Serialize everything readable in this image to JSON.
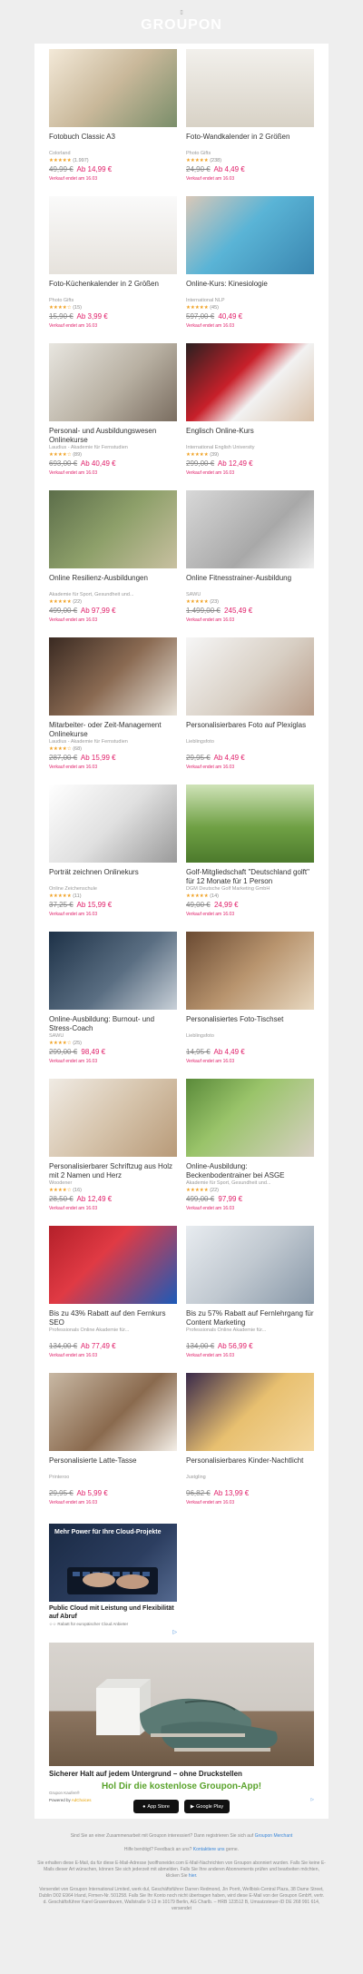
{
  "header": {
    "logo_alt": "Groupon",
    "logo_text": "GROUPON"
  },
  "deals": [
    {
      "title": "Fotobuch Classic A3",
      "merchant": "Colorland",
      "stars": "★★★★★",
      "reviews": "(1.997)",
      "old_price": "49,99 €",
      "new_price": "Ab 14,99 €",
      "ends": "Verkauf endet am 16.03"
    },
    {
      "title": "Foto-Wandkalender in 2 Größen",
      "merchant": "Photo Gifts",
      "stars": "★★★★★",
      "reviews": "(238)",
      "old_price": "24,90 €",
      "new_price": "Ab 4,49 €",
      "ends": "Verkauf endet am 16.03"
    },
    {
      "title": "Foto-Küchenkalender in 2 Größen",
      "merchant": "Photo Gifts",
      "stars": "★★★★☆",
      "reviews": "(15)",
      "old_price": "15,90 €",
      "new_price": "Ab 3,99 €",
      "ends": "Verkauf endet am 16.03"
    },
    {
      "title": "Online-Kurs: Kinesiologie",
      "merchant": "International NLP",
      "stars": "★★★★★",
      "reviews": "(45)",
      "old_price": "597,00 €",
      "new_price": "40,49 €",
      "ends": "Verkauf endet am 16.03"
    },
    {
      "title": "Personal- und Ausbildungswesen Onlinekurse",
      "merchant": "Laudius - Akademie für Fernstudien",
      "stars": "★★★★☆",
      "reviews": "(89)",
      "old_price": "693,00 €",
      "new_price": "Ab 40,49 €",
      "ends": "Verkauf endet am 16.03"
    },
    {
      "title": "Englisch Online-Kurs",
      "merchant": "International English University",
      "stars": "★★★★★",
      "reviews": "(39)",
      "old_price": "299,00 €",
      "new_price": "Ab 12,49 €",
      "ends": "Verkauf endet am 16.03"
    },
    {
      "title": "Online Resilienz-Ausbildungen",
      "merchant": "Akademie für Sport, Gesundheit und...",
      "stars": "★★★★★",
      "reviews": "(22)",
      "old_price": "499,00 €",
      "new_price": "Ab 97,99 €",
      "ends": "Verkauf endet am 16.03"
    },
    {
      "title": "Online Fitnesstrainer-Ausbildung",
      "merchant": "SAWU",
      "stars": "★★★★★",
      "reviews": "(23)",
      "old_price": "1.499,00 €",
      "new_price": "245,49 €",
      "ends": "Verkauf endet am 16.03"
    },
    {
      "title": "Mitarbeiter- oder Zeit-Management Onlinekurse",
      "merchant": "Laudius - Akademie für Fernstudien",
      "stars": "★★★★☆",
      "reviews": "(68)",
      "old_price": "287,00 €",
      "new_price": "Ab 15,99 €",
      "ends": "Verkauf endet am 16.03"
    },
    {
      "title": "Personalisierbares Foto auf Plexiglas",
      "merchant": "Lieblingsfoto",
      "stars": "",
      "reviews": "",
      "old_price": "29,95 €",
      "new_price": "Ab 4,49 €",
      "ends": "Verkauf endet am 16.03"
    },
    {
      "title": "Porträt zeichnen Onlinekurs",
      "merchant": "Online Zeichenschule",
      "stars": "★★★★★",
      "reviews": "(11)",
      "old_price": "37,25 €",
      "new_price": "Ab 15,99 €",
      "ends": "Verkauf endet am 16.03"
    },
    {
      "title": "Golf-Mitgliedschaft \"Deutschland golft\" für 12 Monate für 1 Person",
      "merchant": "DGM Deutsche Golf Marketing GmbH",
      "stars": "★★★★★",
      "reviews": "(14)",
      "old_price": "49,00 €",
      "new_price": "24,99 €",
      "ends": "Verkauf endet am 16.03"
    },
    {
      "title": "Online-Ausbildung: Burnout- und Stress-Coach",
      "merchant": "SAWU",
      "stars": "★★★★☆",
      "reviews": "(25)",
      "old_price": "299,00 €",
      "new_price": "98,49 €",
      "ends": "Verkauf endet am 16.03"
    },
    {
      "title": "Personalisiertes Foto-Tischset",
      "merchant": "Lieblingsfoto",
      "stars": "",
      "reviews": "",
      "old_price": "14,95 €",
      "new_price": "Ab 4,49 €",
      "ends": "Verkauf endet am 16.03"
    },
    {
      "title": "Personalisierbarer Schriftzug aus Holz mit 2 Namen und Herz",
      "merchant": "Woodener",
      "stars": "★★★★☆",
      "reviews": "(16)",
      "old_price": "28,50 €",
      "new_price": "Ab 12,49 €",
      "ends": "Verkauf endet am 16.03"
    },
    {
      "title": "Online-Ausbildung: Beckenbodentrainer bei ASGE",
      "merchant": "Akademie für Sport, Gesundheit und...",
      "stars": "★★★★★",
      "reviews": "(22)",
      "old_price": "499,00 €",
      "new_price": "97,99 €",
      "ends": "Verkauf endet am 16.03"
    },
    {
      "title": "Bis zu 43% Rabatt auf den Fernkurs SEO",
      "merchant": "Professionals Online Akademie für...",
      "stars": "",
      "reviews": "",
      "old_price": "134,00 €",
      "new_price": "Ab 77,49 €",
      "ends": "Verkauf endet am 16.03"
    },
    {
      "title": "Bis zu 57% Rabatt auf Fernlehrgang für Content Marketing",
      "merchant": "Professionals Online Akademie für...",
      "stars": "",
      "reviews": "",
      "old_price": "134,00 €",
      "new_price": "Ab 56,99 €",
      "ends": "Verkauf endet am 16.03"
    },
    {
      "title": "Personalisierte Latte-Tasse",
      "merchant": "Printeroo",
      "stars": "",
      "reviews": "",
      "old_price": "29,95 €",
      "new_price": "Ab 5,99 €",
      "ends": "Verkauf endet am 16.03"
    },
    {
      "title": "Personalisierbares Kinder-Nachtlicht",
      "merchant": "Justgling",
      "stars": "",
      "reviews": "",
      "old_price": "96,82 €",
      "new_price": "Ab 13,99 €",
      "ends": "Verkauf endet am 16.03"
    }
  ],
  "ad1": {
    "headline": "Mehr Power für Ihre Cloud-Projekte",
    "title": "Public Cloud mit Leistung und Flexibilität auf Abruf",
    "sub": "☆☆ Rabatt für europäischer Cloud Anbieter",
    "choices": "▷"
  },
  "ad2": {
    "title": "Sicherer Halt auf jedem Untergrund – ohne Druckstellen",
    "source": "Grupon Kaufen®",
    "powered": "Powered by",
    "brand": "AdChoices",
    "choices": "▷"
  },
  "footer": {
    "app_title": "Hol Dir die kostenlose Groupon-App!",
    "appstore": "App Store",
    "googleplay": "Google Play",
    "merchant_q": "Sind Sie an einer Zusammenarbeit mit Groupon interessiert? Dann registrieren Sie sich auf",
    "merchant_link": "Groupon Merchant",
    "help_pre": "Hilfe benötigt? Feedback an uns?",
    "help_link": "Kontaktiere uns",
    "help_post": "gerne.",
    "unsub": "Sie erhalten diese E-Mail, da für diese E-Mail-Adresse (wolfhsneider.com E-Mail-Nachrichten von Groupon abonniert wurden. Falls Sie keine E-Mails dieser Art wünschen, können Sie sich jederzeit mit abmelden. Falls Sie Ihre anderen Abonnements prüfen und bearbeiten möchten, klicken Sie",
    "unsub_link": "hier",
    "address": "Versendet von Groupon International Limited, werk dul, Geschäftsführer Darren Redmond, Jin Porrit, Wellbisk-Central Plaza, 38 Dame Street, Dublin D02 E964 Irland, Firmen-Nr. 501258. Falls Sie Ihr Konto noch nicht übertragen haben, wird diese E-Mail von der Groupon GmbH, vertr. d. Geschäftsführer Karel Gruwenbuven, Wallstraße 9-13 in 10179 Berlin, AG Charlb. – HRB 123512 B, Umsatzsteuer-ID DE 268 991 614, versendet"
  }
}
